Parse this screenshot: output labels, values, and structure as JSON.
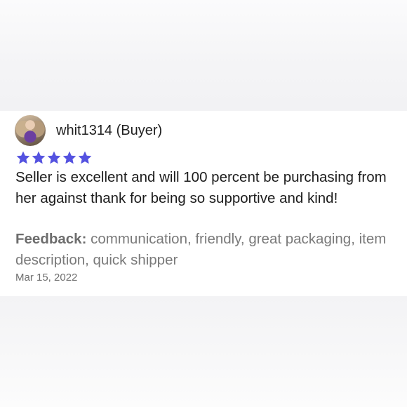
{
  "review": {
    "username": "whit1314 (Buyer)",
    "rating": 5,
    "star_color": "#5452e0",
    "text": "Seller is excellent and will 100 percent be purchasing from her against thank for being so supportive and kind!",
    "feedback_label": "Feedback:",
    "feedback_items": "communication, friendly, great packaging, item description, quick shipper",
    "date": "Mar 15, 2022"
  }
}
